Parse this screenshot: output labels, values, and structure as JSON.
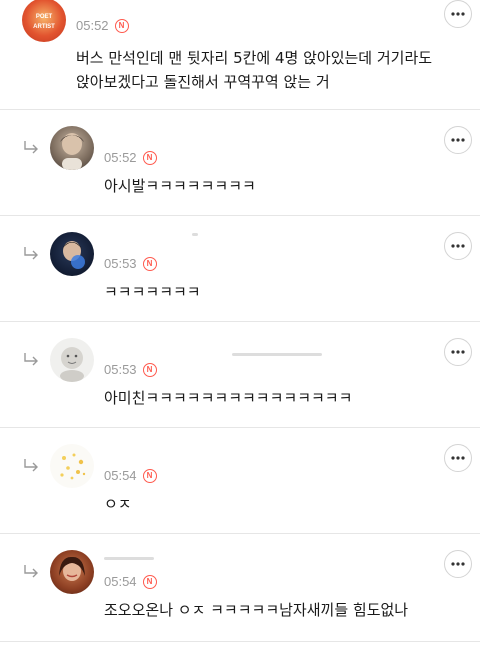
{
  "comments": [
    {
      "time": "05:52",
      "badge": "N",
      "text": "버스 만석인데 맨 뒷자리 5칸에 4명 앉아있는데 거기라도 앉아보겠다고 돌진해서 꾸역꾸역 앉는 거",
      "avatar_text_1": "POET",
      "avatar_text_2": "ARTIST"
    },
    {
      "time": "05:52",
      "badge": "N",
      "text": "아시발ㅋㅋㅋㅋㅋㅋㅋㅋ"
    },
    {
      "time": "05:53",
      "badge": "N",
      "text": "ㅋㅋㅋㅋㅋㅋㅋ"
    },
    {
      "time": "05:53",
      "badge": "N",
      "text": "아미친ㅋㅋㅋㅋㅋㅋㅋㅋㅋㅋㅋㅋㅋㅋㅋ"
    },
    {
      "time": "05:54",
      "badge": "N",
      "text": "ㅇㅈ"
    },
    {
      "time": "05:54",
      "badge": "N",
      "text": "조오오온나 ㅇㅈ ㅋㅋㅋㅋㅋ남자새끼들 힘도없나"
    }
  ],
  "icons": {
    "more": "more-horizontal-icon",
    "reply": "reply-arrow-icon",
    "new": "new-badge-icon"
  },
  "colors": {
    "accent": "#ff5a4e",
    "time": "#9a9a9a",
    "divider": "#e6e6e6"
  }
}
